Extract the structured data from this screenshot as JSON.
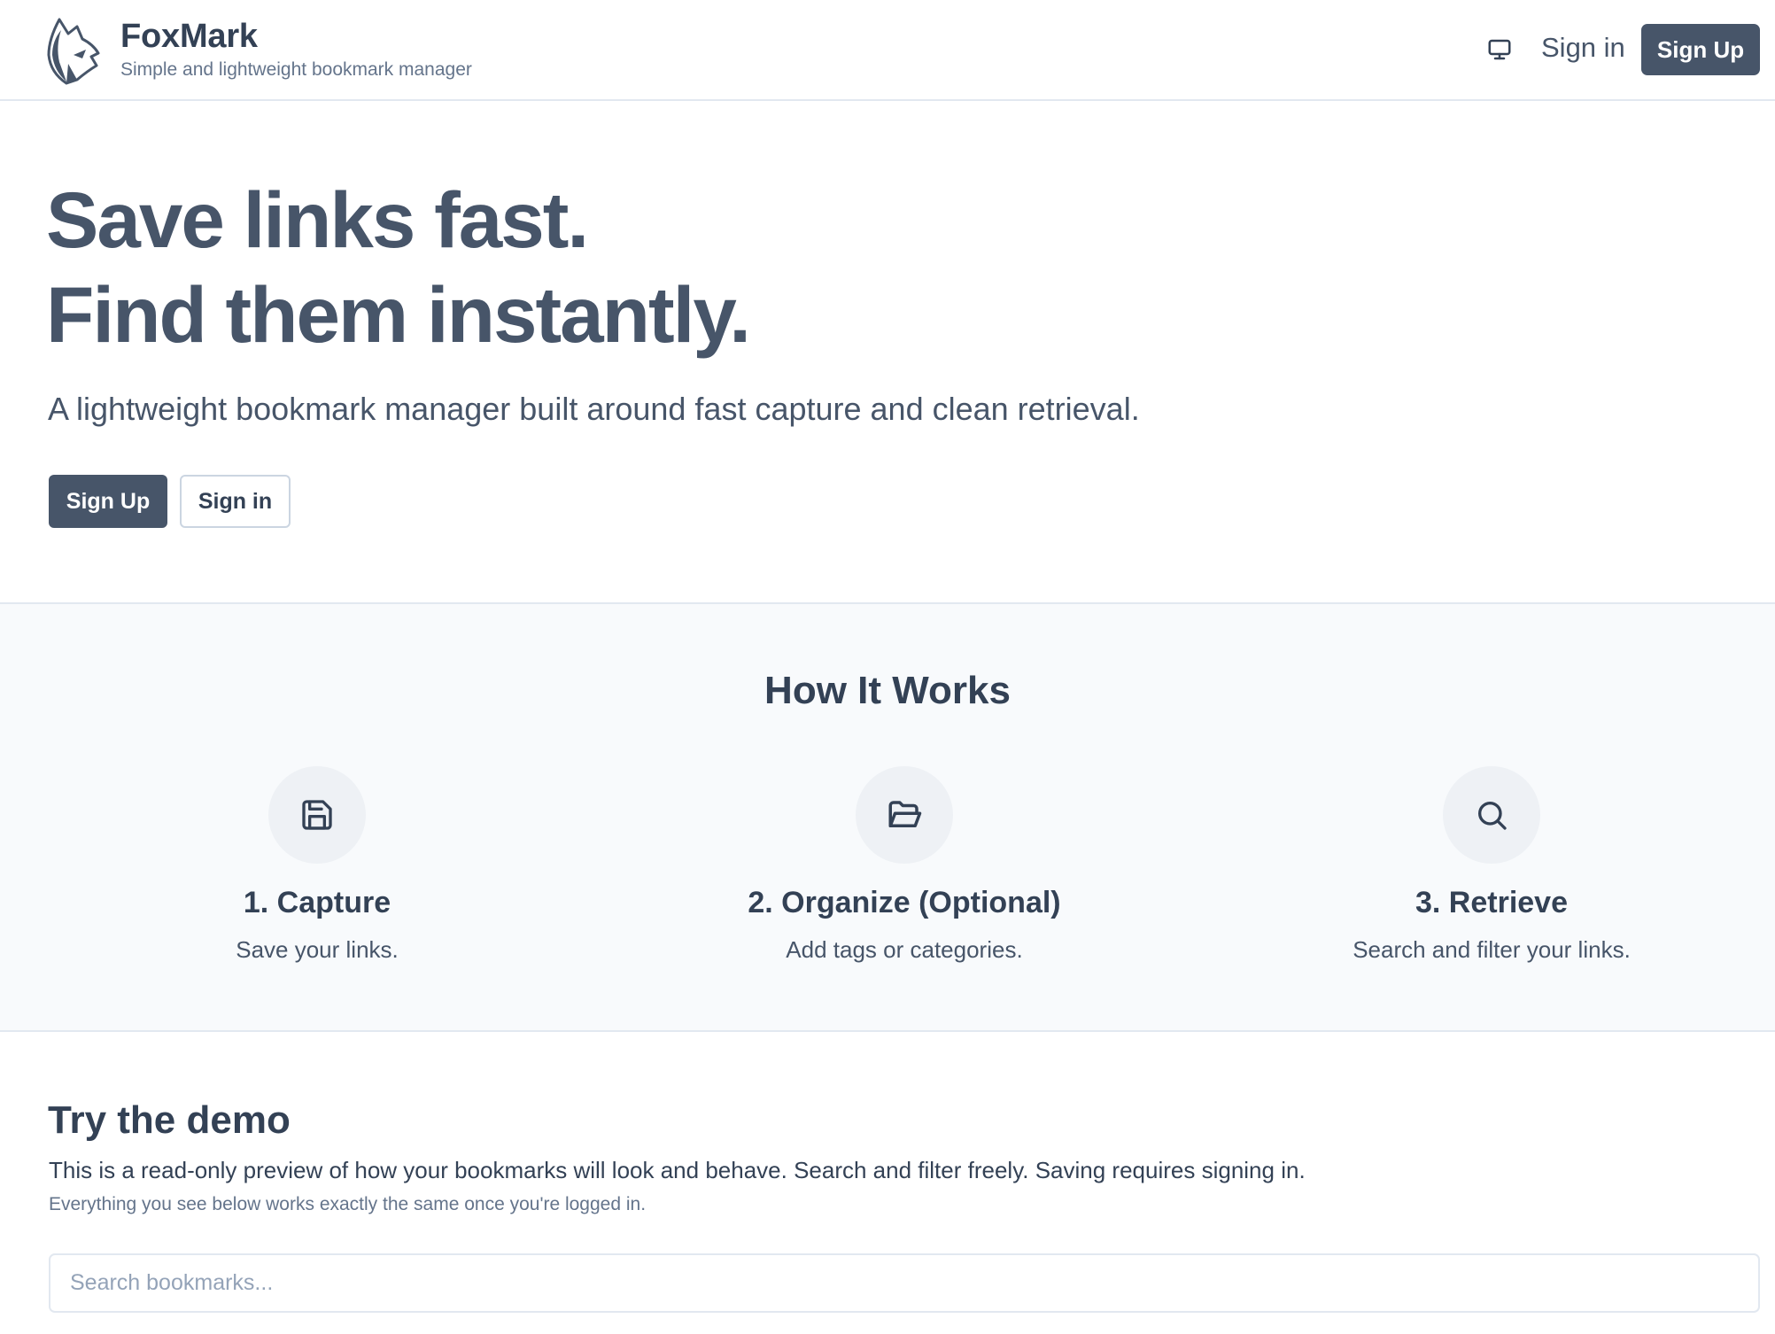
{
  "header": {
    "brand": "FoxMark",
    "tagline": "Simple and lightweight bookmark manager",
    "theme_icon": "monitor-icon",
    "signin_label": "Sign in",
    "signup_label": "Sign Up"
  },
  "hero": {
    "headline_line1": "Save links fast.",
    "headline_line2": "Find them instantly.",
    "subtitle": "A lightweight bookmark manager built around fast capture and clean retrieval.",
    "primary_label": "Sign Up",
    "secondary_label": "Sign in"
  },
  "how_it_works": {
    "title": "How It Works",
    "steps": [
      {
        "icon": "save-icon",
        "title": "1. Capture",
        "desc": "Save your links."
      },
      {
        "icon": "folder-open-icon",
        "title": "2. Organize (Optional)",
        "desc": "Add tags or categories."
      },
      {
        "icon": "search-icon",
        "title": "3. Retrieve",
        "desc": "Search and filter your links."
      }
    ]
  },
  "demo": {
    "title": "Try the demo",
    "description": "This is a read-only preview of how your bookmarks will look and behave. Search and filter freely. Saving requires signing in.",
    "note": "Everything you see below works exactly the same once you're logged in.",
    "search_placeholder": "Search bookmarks...",
    "search_value": ""
  },
  "colors": {
    "primary": "#475569",
    "heading": "#334155",
    "muted": "#64748b",
    "border": "#e2e8f0",
    "section_bg": "#f8fafc"
  }
}
